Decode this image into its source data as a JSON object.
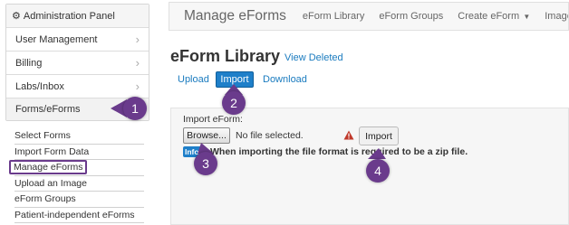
{
  "sidebar": {
    "header": "Administration Panel",
    "items": [
      {
        "label": "User Management"
      },
      {
        "label": "Billing"
      },
      {
        "label": "Labs/Inbox"
      },
      {
        "label": "Forms/eForms"
      }
    ],
    "sub_items": [
      {
        "label": "Select Forms"
      },
      {
        "label": "Import Form Data"
      },
      {
        "label": "Manage eForms"
      },
      {
        "label": "Upload an Image"
      },
      {
        "label": "eForm Groups"
      },
      {
        "label": "Patient-independent eForms"
      }
    ]
  },
  "topnav": {
    "brand": "Manage eForms",
    "links": [
      "eForm Library",
      "eForm Groups",
      "Create eForm",
      "Image Library"
    ]
  },
  "main": {
    "title": "eForm Library",
    "view_deleted": "View Deleted",
    "tabs": [
      "Upload",
      "Import",
      "Download"
    ],
    "import_label": "Import eForm:",
    "browse_label": "Browse...",
    "file_status": "No file selected.",
    "import_button": "Import",
    "info_badge": "Info",
    "info_text": "When importing the file format is required to be a zip file."
  },
  "callouts": [
    "1",
    "2",
    "3",
    "4"
  ],
  "colors": {
    "accent": "#1e7fc9",
    "callout": "#6a3b8c",
    "warning": "#c0392b"
  }
}
